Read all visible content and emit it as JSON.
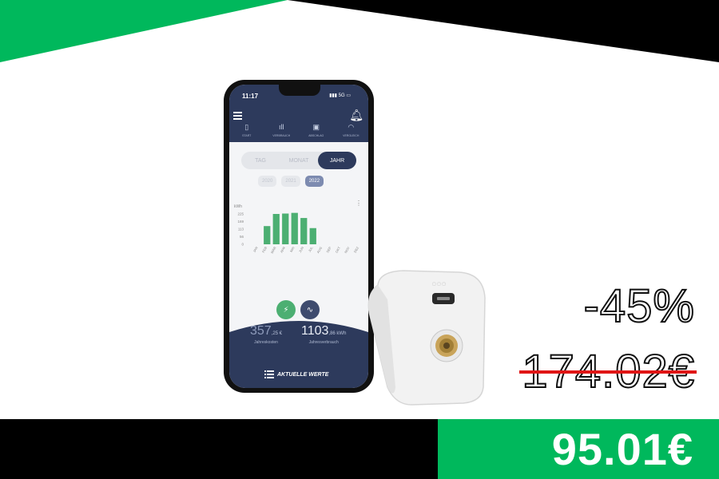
{
  "colors": {
    "green": "#00b85c",
    "black": "#000000",
    "strike": "#e01515",
    "navy": "#2d3a5c",
    "bar": "#4caf72"
  },
  "offer": {
    "discount": "-45%",
    "old_price": "174.02€",
    "new_price": "95.01€"
  },
  "app": {
    "status_time": "11:17",
    "status_net": "5G",
    "menu_icon": "menu-icon",
    "bell_icon": "bell-icon",
    "nav": [
      {
        "label": "START",
        "icon": "home-icon"
      },
      {
        "label": "VERBRAUCH",
        "icon": "bar-chart-icon"
      },
      {
        "label": "ABSCHLAG",
        "icon": "wallet-icon"
      },
      {
        "label": "VERGLEICH",
        "icon": "gauge-icon"
      }
    ],
    "periods": [
      "TAG",
      "MONAT",
      "JAHR"
    ],
    "active_period": "JAHR",
    "years": [
      "2020",
      "2021",
      "2022"
    ],
    "active_year": "2022",
    "stats": {
      "cost_value": "357",
      "cost_unit": ",25 €",
      "cost_label": "Jahreskosten",
      "usage_value": "1103",
      "usage_unit": ",86 kWh",
      "usage_label": "Jahresverbrauch"
    },
    "current_values": "AKTUELLE WERTE"
  },
  "chart_data": {
    "type": "bar",
    "ylabel": "kWh",
    "yticks": [
      0,
      56,
      113,
      169,
      225
    ],
    "ylim": [
      0,
      225
    ],
    "categories": [
      "JAN",
      "FEB",
      "MÄR",
      "APR",
      "MAI",
      "JUN",
      "JUL",
      "AUG",
      "SEP",
      "OKT",
      "NOV",
      "DEZ"
    ],
    "values": [
      0,
      135,
      225,
      228,
      233,
      195,
      120,
      0,
      0,
      0,
      0,
      0
    ],
    "grid": false
  }
}
